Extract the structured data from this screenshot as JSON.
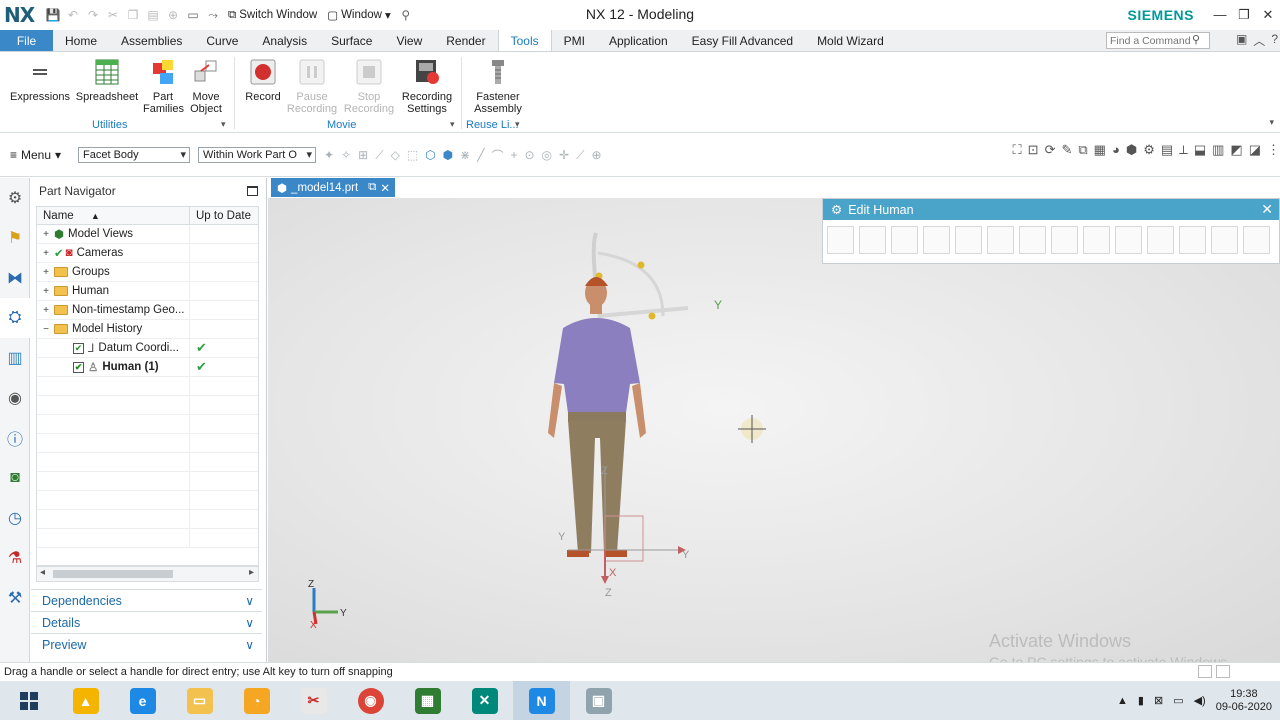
{
  "titlebar": {
    "logo": "NX",
    "switch_window": "Switch Window",
    "window_menu": "Window",
    "title": "NX 12 - Modeling",
    "brand": "SIEMENS"
  },
  "tabs": {
    "file": "File",
    "items": [
      "Home",
      "Assemblies",
      "Curve",
      "Analysis",
      "Surface",
      "View",
      "Render",
      "Tools",
      "PMI",
      "Application",
      "Easy Fill Advanced",
      "Mold Wizard"
    ],
    "active": "Tools",
    "find_placeholder": "Find a Command"
  },
  "ribbon": {
    "expressions": "Expressions",
    "spreadsheet": "Spreadsheet",
    "part_families_1": "Part",
    "part_families_2": "Families",
    "move_object_1": "Move",
    "move_object_2": "Object",
    "record": "Record",
    "pause_1": "Pause",
    "pause_2": "Recording",
    "stop_1": "Stop",
    "stop_2": "Recording",
    "rec_settings_1": "Recording",
    "rec_settings_2": "Settings",
    "fastener_1": "Fastener",
    "fastener_2": "Assembly",
    "group_utilities": "Utilities",
    "group_movie": "Movie",
    "group_reuse": "Reuse Li..."
  },
  "selbar": {
    "menu": "Menu",
    "filter_type": "Facet Body",
    "filter_scope": "Within Work Part O"
  },
  "navigator": {
    "title": "Part Navigator",
    "col_name": "Name",
    "col_uptodate": "Up to Date",
    "rows": [
      {
        "label": "Model Views"
      },
      {
        "label": "Cameras"
      },
      {
        "label": "Groups"
      },
      {
        "label": "Human"
      },
      {
        "label": "Non-timestamp Geo..."
      },
      {
        "label": "Model History"
      },
      {
        "label": "Datum Coordi..."
      },
      {
        "label": "Human (1)"
      }
    ],
    "panels": [
      "Dependencies",
      "Details",
      "Preview"
    ]
  },
  "graphics": {
    "doc_tab": "_model14.prt",
    "axis_labels": {
      "y": "Y",
      "x": "X",
      "z": "Z"
    }
  },
  "edit_human": {
    "title": "Edit Human"
  },
  "watermark": {
    "line1": "Activate Windows",
    "line2": "Go to PC settings to activate Windows."
  },
  "status": {
    "text": "Drag a handle or select a handle for direct entry; use Alt key to turn off snapping"
  },
  "taskbar": {
    "time": "19:38",
    "date": "09-06-2020"
  },
  "colors": {
    "accent": "#3a88c8",
    "brand": "#009999",
    "dialog_title": "#4aa3c8"
  }
}
